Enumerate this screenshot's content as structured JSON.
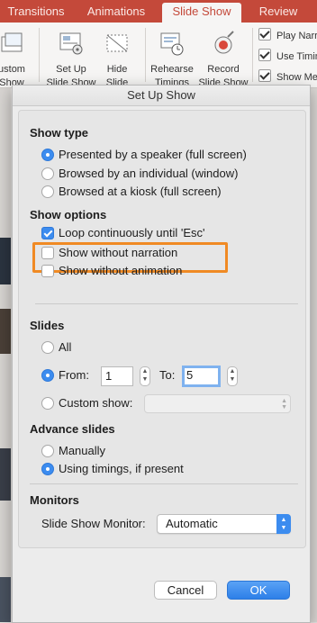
{
  "ribbon": {
    "tabs": [
      {
        "label": "Transitions"
      },
      {
        "label": "Animations"
      },
      {
        "label": "Slide Show"
      },
      {
        "label": "Review"
      }
    ],
    "buttons": [
      {
        "label_line1": "ustom",
        "label_line2": "Show"
      },
      {
        "label_line1": "Set Up",
        "label_line2": "Slide Show"
      },
      {
        "label_line1": "Hide",
        "label_line2": "Slide"
      },
      {
        "label_line1": "Rehearse",
        "label_line2": "Timings"
      },
      {
        "label_line1": "Record",
        "label_line2": "Slide Show"
      }
    ],
    "checkboxes": [
      {
        "label": "Play Narra"
      },
      {
        "label": "Use Timin"
      },
      {
        "label": "Show Med"
      }
    ]
  },
  "dialog": {
    "title": "Set Up Show",
    "show_type": {
      "heading": "Show type",
      "options": [
        {
          "label": "Presented by a speaker (full screen)",
          "selected": true
        },
        {
          "label": "Browsed by an individual (window)",
          "selected": false
        },
        {
          "label": "Browsed at a kiosk (full screen)",
          "selected": false
        }
      ]
    },
    "show_options": {
      "heading": "Show options",
      "options": [
        {
          "label": "Loop continuously until 'Esc'",
          "checked": true
        },
        {
          "label": "Show without narration",
          "checked": false
        },
        {
          "label": "Show without animation",
          "checked": false
        }
      ]
    },
    "slides": {
      "heading": "Slides",
      "all_label": "All",
      "from_label": "From:",
      "from_value": "1",
      "to_label": "To:",
      "to_value": "5",
      "custom_label": "Custom show:",
      "selected": "from"
    },
    "advance": {
      "heading": "Advance slides",
      "options": [
        {
          "label": "Manually",
          "selected": false
        },
        {
          "label": "Using timings, if present",
          "selected": true
        }
      ]
    },
    "monitors": {
      "heading": "Monitors",
      "monitor_label": "Slide Show Monitor:",
      "monitor_value": "Automatic"
    },
    "cancel_label": "Cancel",
    "ok_label": "OK"
  },
  "colors": {
    "ribbon_accent": "#c4493a",
    "selection_blue": "#3c8cef",
    "highlight_orange": "#f08a24"
  }
}
